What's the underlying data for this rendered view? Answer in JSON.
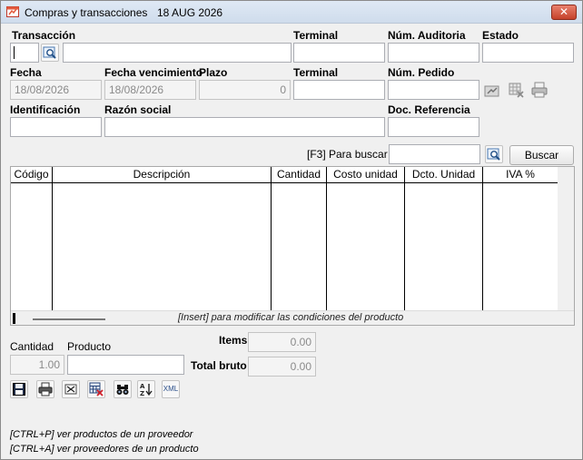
{
  "window": {
    "title": "Compras y transacciones",
    "date": "18 AUG 2026",
    "close_glyph": "✕"
  },
  "header": {
    "transaccion_label": "Transacción",
    "transaccion_code": "",
    "transaccion_desc": "",
    "terminal_label": "Terminal",
    "terminal_value": "",
    "num_auditoria_label": "Núm. Auditoria",
    "num_auditoria_value": "",
    "estado_label": "Estado",
    "estado_value": ""
  },
  "row2": {
    "fecha_label": "Fecha",
    "fecha_value": "18/08/2026",
    "fecha_venc_label": "Fecha vencimiento",
    "fecha_venc_value": "18/08/2026",
    "plazo_label": "Plazo",
    "plazo_value": "0",
    "terminal_label": "Terminal",
    "terminal_value": "",
    "num_pedido_label": "Núm. Pedido",
    "num_pedido_value": ""
  },
  "row3": {
    "identificacion_label": "Identificación",
    "identificacion_value": "",
    "razon_social_label": "Razón social",
    "razon_social_value": "",
    "doc_referencia_label": "Doc. Referencia",
    "doc_referencia_value": ""
  },
  "search": {
    "hint_label": "[F3] Para buscar",
    "value": "",
    "button_label": "Buscar"
  },
  "grid": {
    "columns": [
      "Código",
      "Descripción",
      "Cantidad",
      "Costo unidad",
      "Dcto. Unidad",
      "IVA %"
    ],
    "footer_hint": "[Insert]  para modificar las condiciones del producto"
  },
  "bottom": {
    "cantidad_label": "Cantidad",
    "cantidad_value": "1.00",
    "producto_label": "Producto",
    "producto_value": "",
    "items_label": "Items",
    "items_value": "0.00",
    "total_bruto_label": "Total bruto",
    "total_bruto_value": "0.00",
    "xml_label": "XML"
  },
  "hints": [
    "[CTRL+P] ver productos de un proveedor",
    "[CTRL+A] ver proveedores de un producto"
  ],
  "icons": {
    "app": "app-window-icon",
    "lookup": "magnifier-icon",
    "save": "save-icon",
    "print": "print-icon",
    "close_doc": "close-document-icon",
    "delete": "delete-calculator-icon",
    "binoculars": "binoculars-icon",
    "sort": "sort-az-icon"
  },
  "colors": {
    "window_bg": "#f0f0f0",
    "title_bar": "#dfe9f5",
    "close_button": "#c5422b",
    "disabled_text": "#8a8a8a"
  }
}
